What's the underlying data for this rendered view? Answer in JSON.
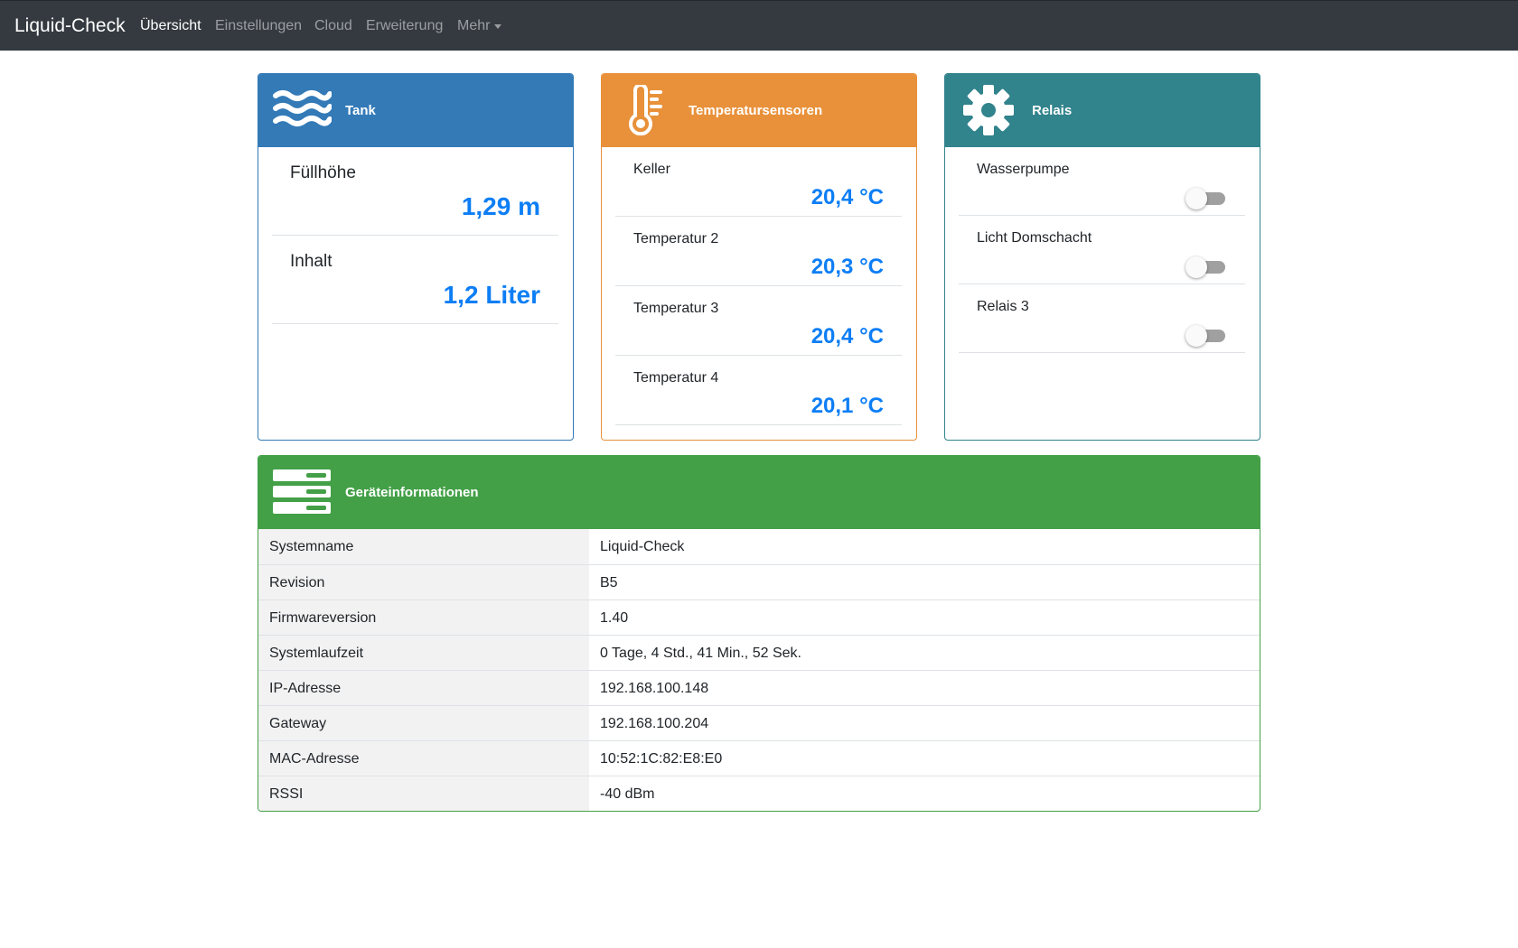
{
  "navbar": {
    "brand": "Liquid-Check",
    "items": [
      {
        "label": "Übersicht",
        "active": true
      },
      {
        "label": "Einstellungen",
        "active": false
      },
      {
        "label": "Cloud",
        "active": false
      },
      {
        "label": "Erweiterung",
        "active": false
      },
      {
        "label": "Mehr",
        "active": false,
        "dropdown": true
      }
    ]
  },
  "tank": {
    "title": "Tank",
    "icon": "waves-icon",
    "rows": [
      {
        "label": "Füllhöhe",
        "value": "1,29 m"
      },
      {
        "label": "Inhalt",
        "value": "1,2 Liter"
      }
    ]
  },
  "temperature": {
    "title": "Temperatursensoren",
    "icon": "thermometer-icon",
    "rows": [
      {
        "label": "Keller",
        "value": "20,4 °C"
      },
      {
        "label": "Temperatur 2",
        "value": "20,3 °C"
      },
      {
        "label": "Temperatur 3",
        "value": "20,4 °C"
      },
      {
        "label": "Temperatur 4",
        "value": "20,1 °C"
      }
    ]
  },
  "relays": {
    "title": "Relais",
    "icon": "gear-icon",
    "rows": [
      {
        "label": "Wasserpumpe",
        "on": false
      },
      {
        "label": "Licht Domschacht",
        "on": false
      },
      {
        "label": "Relais 3",
        "on": false
      }
    ]
  },
  "device_info": {
    "title": "Geräteinformationen",
    "icon": "server-icon",
    "rows": [
      {
        "key": "Systemname",
        "value": "Liquid-Check"
      },
      {
        "key": "Revision",
        "value": "B5"
      },
      {
        "key": "Firmwareversion",
        "value": "1.40"
      },
      {
        "key": "Systemlaufzeit",
        "value": "0 Tage, 4 Std., 41 Min., 52 Sek."
      },
      {
        "key": "IP-Adresse",
        "value": "192.168.100.148"
      },
      {
        "key": "Gateway",
        "value": "192.168.100.204"
      },
      {
        "key": "MAC-Adresse",
        "value": "10:52:1C:82:E8:E0"
      },
      {
        "key": "RSSI",
        "value": "-40 dBm"
      }
    ]
  },
  "colors": {
    "navbar": "#343a40",
    "tank": "#337ab7",
    "temperature": "#e8913a",
    "relays": "#31838c",
    "device_info": "#43a047",
    "value": "#0d7ef5"
  }
}
